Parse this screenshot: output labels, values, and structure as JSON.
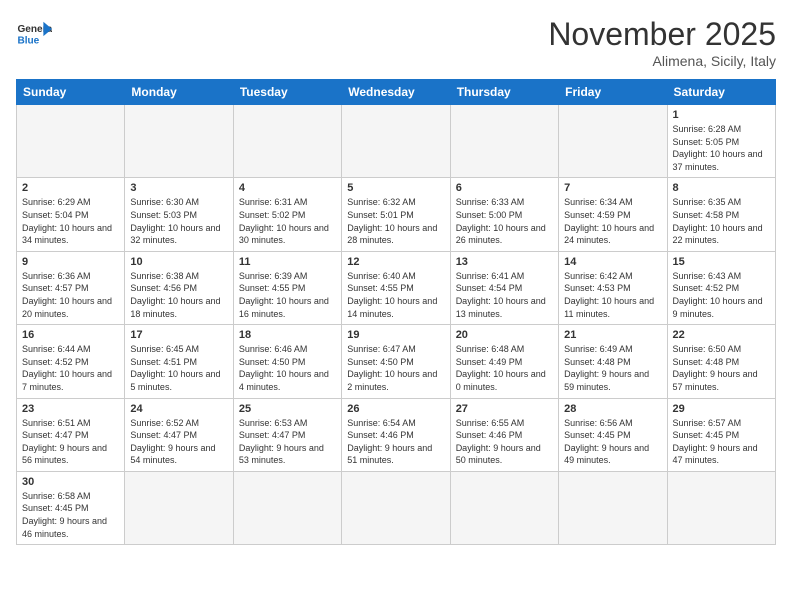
{
  "logo": {
    "text_general": "General",
    "text_blue": "Blue"
  },
  "title": "November 2025",
  "location": "Alimena, Sicily, Italy",
  "days_of_week": [
    "Sunday",
    "Monday",
    "Tuesday",
    "Wednesday",
    "Thursday",
    "Friday",
    "Saturday"
  ],
  "weeks": [
    [
      {
        "day": "",
        "info": ""
      },
      {
        "day": "",
        "info": ""
      },
      {
        "day": "",
        "info": ""
      },
      {
        "day": "",
        "info": ""
      },
      {
        "day": "",
        "info": ""
      },
      {
        "day": "",
        "info": ""
      },
      {
        "day": "1",
        "info": "Sunrise: 6:28 AM\nSunset: 5:05 PM\nDaylight: 10 hours and 37 minutes."
      }
    ],
    [
      {
        "day": "2",
        "info": "Sunrise: 6:29 AM\nSunset: 5:04 PM\nDaylight: 10 hours and 34 minutes."
      },
      {
        "day": "3",
        "info": "Sunrise: 6:30 AM\nSunset: 5:03 PM\nDaylight: 10 hours and 32 minutes."
      },
      {
        "day": "4",
        "info": "Sunrise: 6:31 AM\nSunset: 5:02 PM\nDaylight: 10 hours and 30 minutes."
      },
      {
        "day": "5",
        "info": "Sunrise: 6:32 AM\nSunset: 5:01 PM\nDaylight: 10 hours and 28 minutes."
      },
      {
        "day": "6",
        "info": "Sunrise: 6:33 AM\nSunset: 5:00 PM\nDaylight: 10 hours and 26 minutes."
      },
      {
        "day": "7",
        "info": "Sunrise: 6:34 AM\nSunset: 4:59 PM\nDaylight: 10 hours and 24 minutes."
      },
      {
        "day": "8",
        "info": "Sunrise: 6:35 AM\nSunset: 4:58 PM\nDaylight: 10 hours and 22 minutes."
      }
    ],
    [
      {
        "day": "9",
        "info": "Sunrise: 6:36 AM\nSunset: 4:57 PM\nDaylight: 10 hours and 20 minutes."
      },
      {
        "day": "10",
        "info": "Sunrise: 6:38 AM\nSunset: 4:56 PM\nDaylight: 10 hours and 18 minutes."
      },
      {
        "day": "11",
        "info": "Sunrise: 6:39 AM\nSunset: 4:55 PM\nDaylight: 10 hours and 16 minutes."
      },
      {
        "day": "12",
        "info": "Sunrise: 6:40 AM\nSunset: 4:55 PM\nDaylight: 10 hours and 14 minutes."
      },
      {
        "day": "13",
        "info": "Sunrise: 6:41 AM\nSunset: 4:54 PM\nDaylight: 10 hours and 13 minutes."
      },
      {
        "day": "14",
        "info": "Sunrise: 6:42 AM\nSunset: 4:53 PM\nDaylight: 10 hours and 11 minutes."
      },
      {
        "day": "15",
        "info": "Sunrise: 6:43 AM\nSunset: 4:52 PM\nDaylight: 10 hours and 9 minutes."
      }
    ],
    [
      {
        "day": "16",
        "info": "Sunrise: 6:44 AM\nSunset: 4:52 PM\nDaylight: 10 hours and 7 minutes."
      },
      {
        "day": "17",
        "info": "Sunrise: 6:45 AM\nSunset: 4:51 PM\nDaylight: 10 hours and 5 minutes."
      },
      {
        "day": "18",
        "info": "Sunrise: 6:46 AM\nSunset: 4:50 PM\nDaylight: 10 hours and 4 minutes."
      },
      {
        "day": "19",
        "info": "Sunrise: 6:47 AM\nSunset: 4:50 PM\nDaylight: 10 hours and 2 minutes."
      },
      {
        "day": "20",
        "info": "Sunrise: 6:48 AM\nSunset: 4:49 PM\nDaylight: 10 hours and 0 minutes."
      },
      {
        "day": "21",
        "info": "Sunrise: 6:49 AM\nSunset: 4:48 PM\nDaylight: 9 hours and 59 minutes."
      },
      {
        "day": "22",
        "info": "Sunrise: 6:50 AM\nSunset: 4:48 PM\nDaylight: 9 hours and 57 minutes."
      }
    ],
    [
      {
        "day": "23",
        "info": "Sunrise: 6:51 AM\nSunset: 4:47 PM\nDaylight: 9 hours and 56 minutes."
      },
      {
        "day": "24",
        "info": "Sunrise: 6:52 AM\nSunset: 4:47 PM\nDaylight: 9 hours and 54 minutes."
      },
      {
        "day": "25",
        "info": "Sunrise: 6:53 AM\nSunset: 4:47 PM\nDaylight: 9 hours and 53 minutes."
      },
      {
        "day": "26",
        "info": "Sunrise: 6:54 AM\nSunset: 4:46 PM\nDaylight: 9 hours and 51 minutes."
      },
      {
        "day": "27",
        "info": "Sunrise: 6:55 AM\nSunset: 4:46 PM\nDaylight: 9 hours and 50 minutes."
      },
      {
        "day": "28",
        "info": "Sunrise: 6:56 AM\nSunset: 4:45 PM\nDaylight: 9 hours and 49 minutes."
      },
      {
        "day": "29",
        "info": "Sunrise: 6:57 AM\nSunset: 4:45 PM\nDaylight: 9 hours and 47 minutes."
      }
    ],
    [
      {
        "day": "30",
        "info": "Sunrise: 6:58 AM\nSunset: 4:45 PM\nDaylight: 9 hours and 46 minutes."
      },
      {
        "day": "",
        "info": ""
      },
      {
        "day": "",
        "info": ""
      },
      {
        "day": "",
        "info": ""
      },
      {
        "day": "",
        "info": ""
      },
      {
        "day": "",
        "info": ""
      },
      {
        "day": "",
        "info": ""
      }
    ]
  ]
}
